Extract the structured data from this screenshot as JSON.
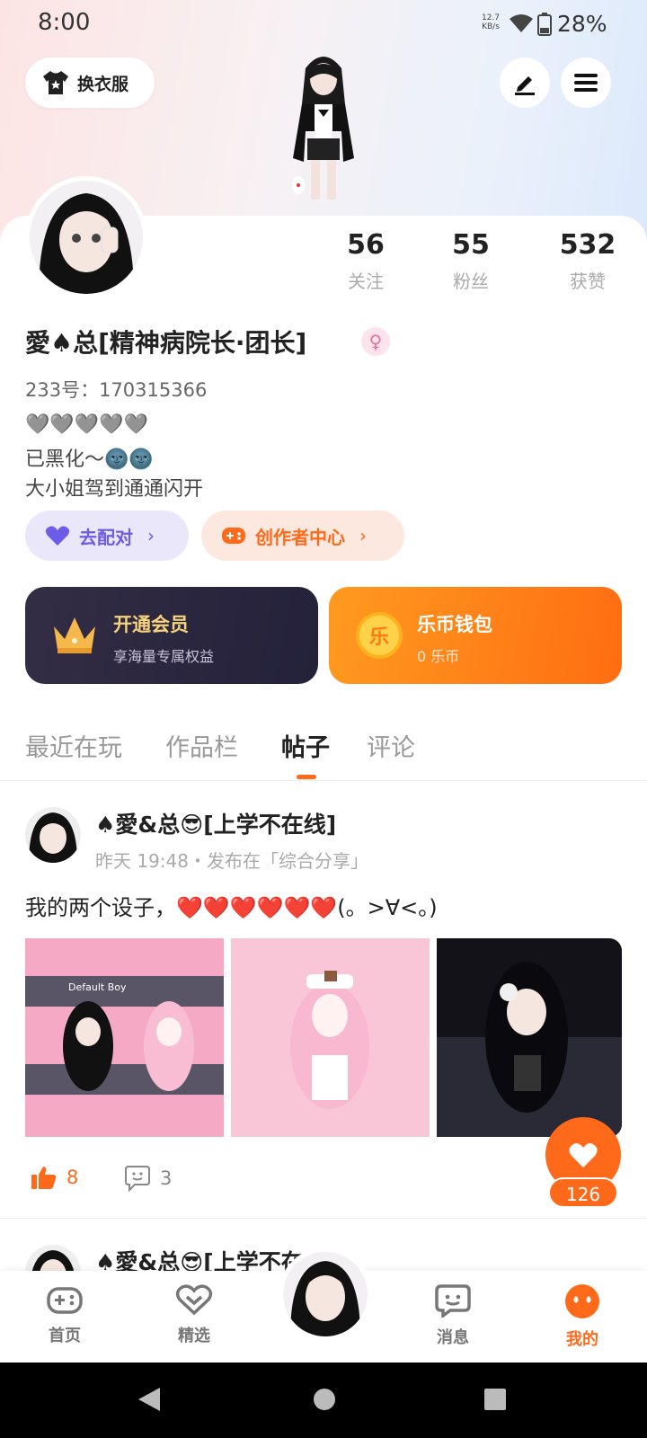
{
  "status_bar": {
    "time": "8:00",
    "net_speed_top": "12.7",
    "net_speed_unit": "KB/s",
    "battery": "28%"
  },
  "header": {
    "outfit_label": "换衣服",
    "edit_icon": "pen-icon",
    "menu_icon": "hamburger-menu-icon"
  },
  "profile": {
    "stats": [
      {
        "value": "56",
        "label": "关注"
      },
      {
        "value": "55",
        "label": "粉丝"
      },
      {
        "value": "532",
        "label": "获赞"
      }
    ],
    "name": "愛♠总[精神病院长·团长]",
    "gender_symbol": "♀",
    "id_line": "233号：170315366",
    "bio": [
      "🩶🩶🩶🩶🩶",
      "已黑化～🌚🌚",
      "大小姐驾到通通闪开"
    ]
  },
  "actions": {
    "match_label": "去配对",
    "creator_label": "创作者中心"
  },
  "vip": {
    "title": "开通会员",
    "subtitle": "享海量专属权益"
  },
  "wallet": {
    "title": "乐币钱包",
    "subtitle": "0 乐币",
    "coin_char": "乐"
  },
  "tabs": [
    {
      "label": "最近在玩"
    },
    {
      "label": "作品栏"
    },
    {
      "label": "帖子"
    },
    {
      "label": "评论"
    }
  ],
  "post": {
    "author": "♠愛&总😎[上学不在线]",
    "meta": "昨天 19:48・发布在「综合分享」",
    "text": "我的两个设子，❤️❤️❤️❤️❤️❤️(。>∀<。)",
    "image1_caption": "Default Boy",
    "likes": "8",
    "comments": "3",
    "favorites": "126"
  },
  "post2": {
    "author": "♠愛&总😎[上学不在线]"
  },
  "bottom_nav": [
    {
      "label": "首页"
    },
    {
      "label": "精选"
    },
    {
      "label": "消息"
    },
    {
      "label": "我的"
    }
  ],
  "colors": {
    "accent": "#ff6a1a",
    "purple": "#6c5ce7",
    "vip_bg": "#2c2740",
    "wallet_bg": "#ff8a1a"
  }
}
